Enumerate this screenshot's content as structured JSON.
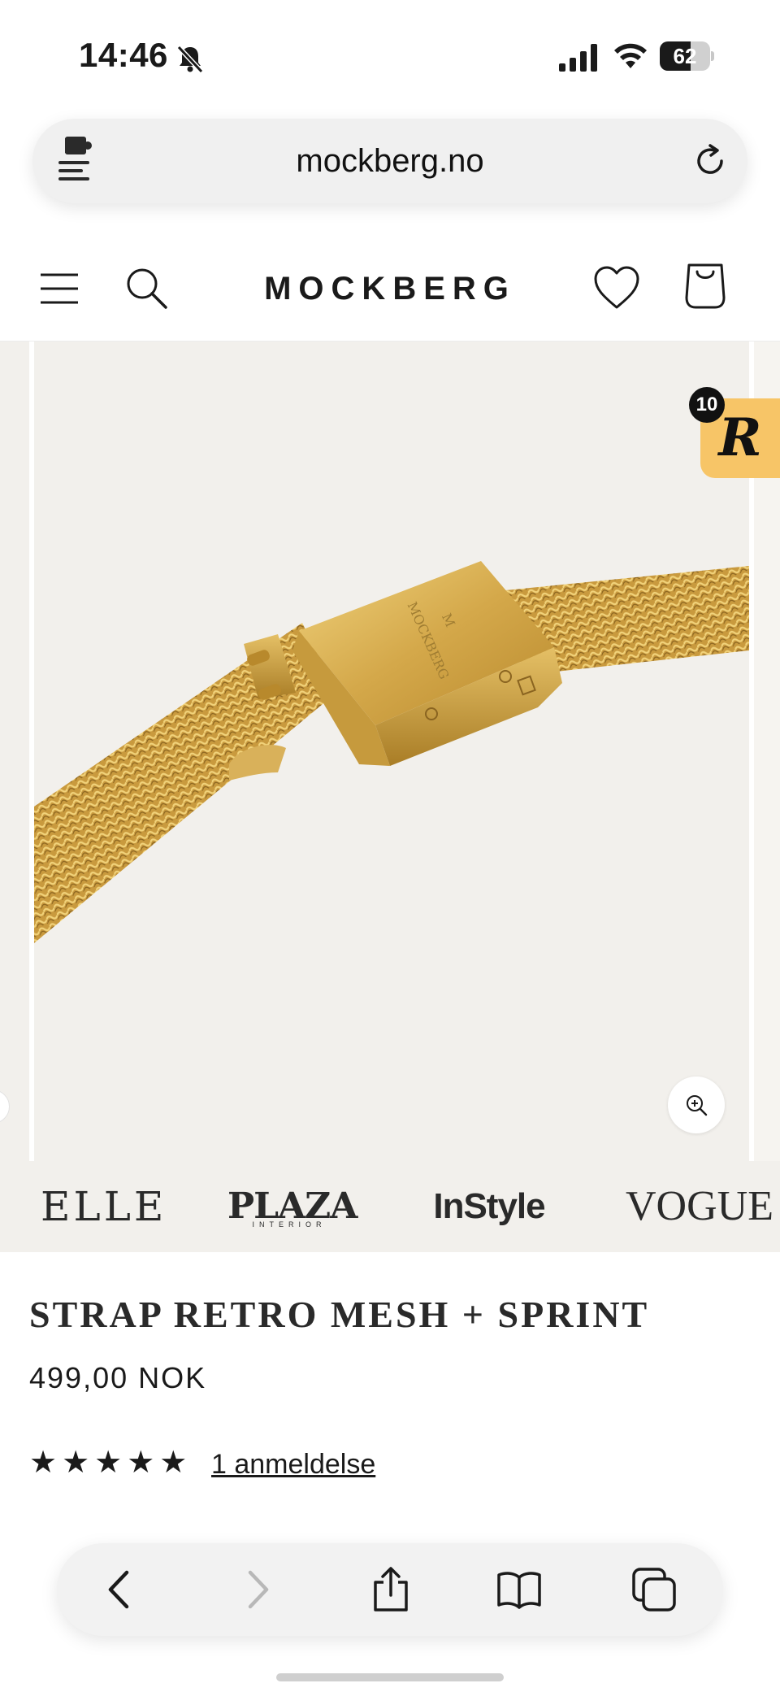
{
  "status_bar": {
    "time": "14:46",
    "battery_percent": "62",
    "battery_level": 0.62,
    "icons": [
      "bell-slash-icon",
      "signal-icon",
      "wifi-icon",
      "battery-icon"
    ]
  },
  "browser": {
    "url": "mockberg.no",
    "icons": [
      "extension-icon",
      "reload-icon"
    ]
  },
  "header": {
    "brand": "MOCKBERG",
    "icons": [
      "menu-icon",
      "search-icon",
      "heart-icon",
      "bag-icon"
    ]
  },
  "gallery": {
    "rewards_letter": "R",
    "rewards_count": "10",
    "icons": [
      "zoom-icon"
    ]
  },
  "press": {
    "elle": "ELLE",
    "plaza": "PLAZA",
    "plaza_sub": "INTERIOR",
    "instyle": "InStyle",
    "vogue": "VOGUE"
  },
  "product": {
    "title": "STRAP RETRO MESH + SPRINT",
    "price": "499,00 NOK",
    "stars": "★★★★★",
    "rating": 5,
    "reviews": "1 anmeldelse"
  },
  "toolbar": {
    "icons": [
      "back-icon",
      "forward-icon",
      "share-icon",
      "bookmarks-icon",
      "tabs-icon"
    ]
  },
  "colors": {
    "accent_rewards": "#f7c567",
    "gallery_bg": "#f2f0ec",
    "gold": "#c9a045"
  }
}
